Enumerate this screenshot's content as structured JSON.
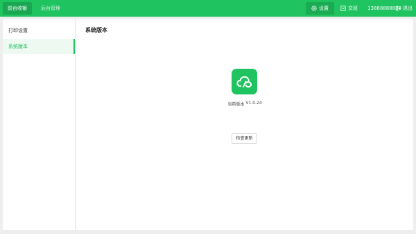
{
  "topbar": {
    "tabs": [
      {
        "label": "前台收银",
        "active": true
      },
      {
        "label": "后台管理",
        "active": false
      }
    ],
    "settings_label": "设置",
    "handover_label": "交班",
    "phone": "13888888888",
    "logout_label": "退出",
    "icons": {
      "settings": "settings-circle-icon",
      "handover": "handover-icon",
      "logout": "logout-icon"
    }
  },
  "sidebar": {
    "items": [
      {
        "label": "打印设置",
        "active": false
      },
      {
        "label": "系统版本",
        "active": true
      }
    ]
  },
  "main": {
    "title": "系统版本",
    "logo_icon": "cloud-app-logo-icon",
    "version_label": "当前版本",
    "version_value": "V1.0.24",
    "update_button": "检查更新"
  },
  "colors": {
    "brand": "#1fc35f",
    "active_bg": "#edf9f1",
    "background": "#eeeeee"
  }
}
